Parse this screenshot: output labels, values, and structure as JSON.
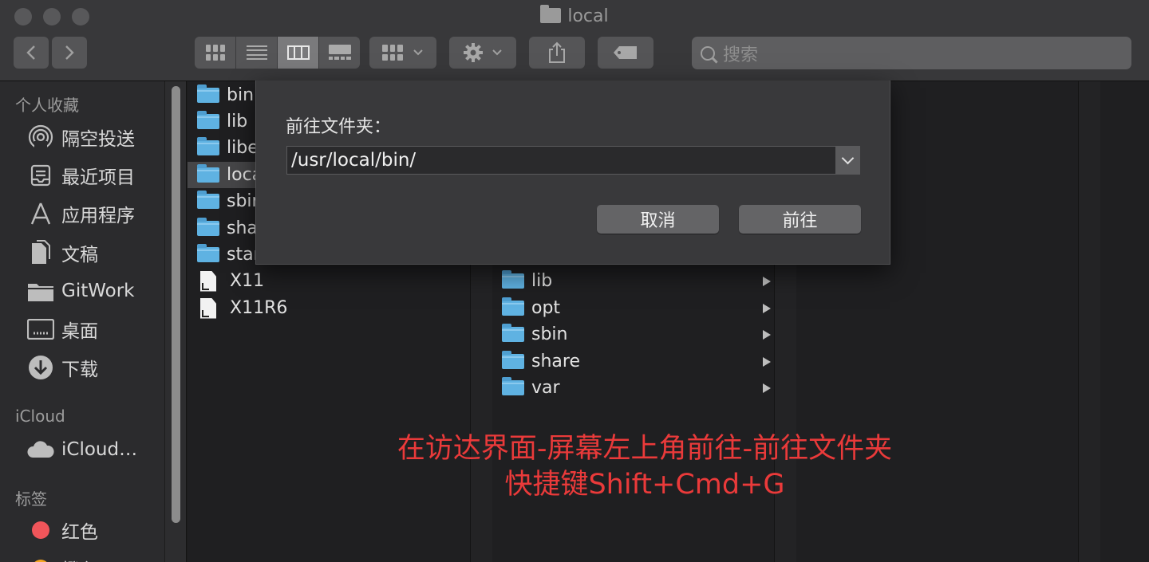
{
  "window": {
    "title": "local"
  },
  "toolbar": {
    "search_placeholder": "搜索"
  },
  "sidebar": {
    "favorites_header": "个人收藏",
    "favorites": [
      {
        "label": "隔空投送",
        "icon": "airdrop-icon"
      },
      {
        "label": "最近项目",
        "icon": "recents-icon"
      },
      {
        "label": "应用程序",
        "icon": "applications-icon"
      },
      {
        "label": "文稿",
        "icon": "documents-icon"
      },
      {
        "label": "GitWork",
        "icon": "folder-icon"
      },
      {
        "label": "桌面",
        "icon": "desktop-icon"
      },
      {
        "label": "下载",
        "icon": "downloads-icon"
      }
    ],
    "icloud_header": "iCloud",
    "icloud": [
      {
        "label": "iCloud…",
        "icon": "cloud-icon"
      }
    ],
    "tags_header": "标签",
    "tags": [
      {
        "label": "红色",
        "color": "#f0555a"
      },
      {
        "label": "橙色",
        "color": "#f5a623"
      }
    ]
  },
  "column1": {
    "items": [
      {
        "name": "bin",
        "type": "folder"
      },
      {
        "name": "lib",
        "type": "folder"
      },
      {
        "name": "libexec",
        "type": "folder"
      },
      {
        "name": "local",
        "type": "folder",
        "selected": true
      },
      {
        "name": "sbin",
        "type": "folder"
      },
      {
        "name": "share",
        "type": "folder"
      },
      {
        "name": "standalone",
        "type": "folder"
      },
      {
        "name": "X11",
        "type": "alias"
      },
      {
        "name": "X11R6",
        "type": "alias"
      }
    ]
  },
  "column2": {
    "items": [
      {
        "name": "lib"
      },
      {
        "name": "opt"
      },
      {
        "name": "sbin"
      },
      {
        "name": "share"
      },
      {
        "name": "var"
      }
    ]
  },
  "dialog": {
    "label": "前往文件夹：",
    "path_value": "/usr/local/bin/",
    "cancel_label": "取消",
    "go_label": "前往"
  },
  "annotation": {
    "line1": "在访达界面-屏幕左上角前往-前往文件夹",
    "line2": "快捷键Shift+Cmd+G",
    "color": "#ea3a3a"
  }
}
